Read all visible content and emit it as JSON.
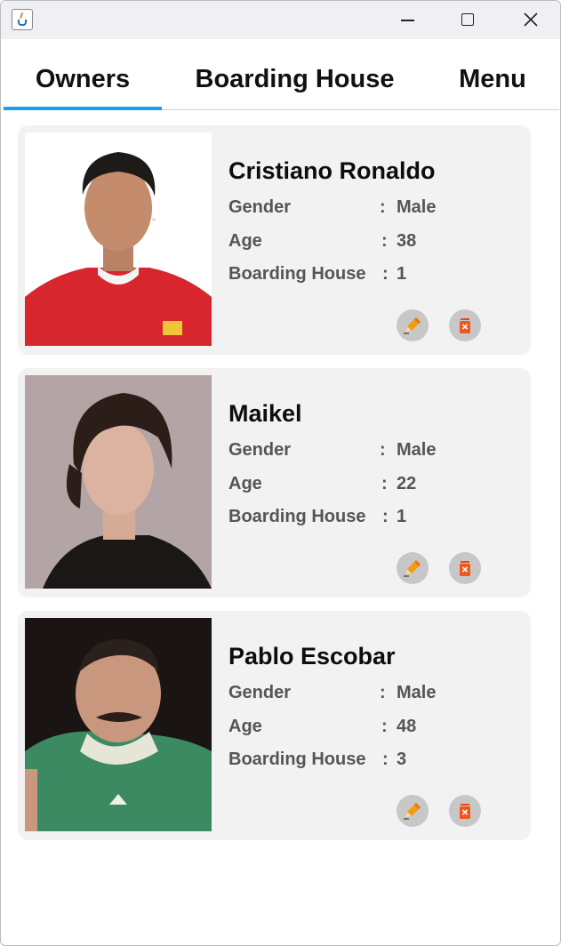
{
  "window": {
    "icon": "java-cup-icon",
    "controls": [
      "minimize-icon",
      "maximize-icon",
      "close-icon"
    ]
  },
  "tabs": [
    {
      "label": "Owners",
      "active": true
    },
    {
      "label": "Boarding House",
      "active": false
    },
    {
      "label": "Menu",
      "active": false
    }
  ],
  "accent_color": "#1aa1e6",
  "field_labels": {
    "gender": "Gender",
    "age": "Age",
    "boarding_house": "Boarding House",
    "separator": ":"
  },
  "owners": [
    {
      "name": "Cristiano Ronaldo",
      "gender": "Male",
      "age": "38",
      "boarding_house": "1"
    },
    {
      "name": "Maikel",
      "gender": "Male",
      "age": "22",
      "boarding_house": "1"
    },
    {
      "name": "Pablo Escobar",
      "gender": "Male",
      "age": "48",
      "boarding_house": "3"
    }
  ],
  "actions": {
    "edit_icon": "pencil-icon",
    "delete_icon": "trash-icon"
  }
}
